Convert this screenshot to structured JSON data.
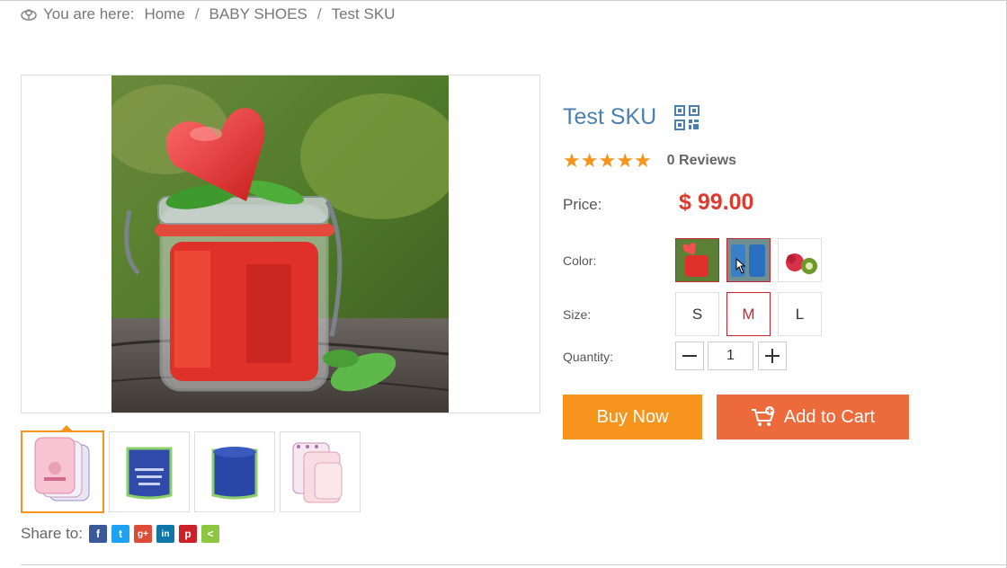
{
  "breadcrumb": {
    "prefix": "You are here:",
    "items": [
      "Home",
      "BABY SHOES",
      "Test SKU"
    ],
    "separator": "/"
  },
  "product": {
    "title": "Test SKU",
    "rating_stars": 5,
    "reviews_label": "0 Reviews",
    "price_label": "Price:",
    "price": "$ 99.00",
    "color_label": "Color:",
    "size_label": "Size:",
    "quantity_label": "Quantity:",
    "sizes": [
      "S",
      "M",
      "L"
    ],
    "selected_size": "M",
    "quantity": "1"
  },
  "actions": {
    "buy_now": "Buy Now",
    "add_to_cart": "Add to Cart"
  },
  "share": {
    "label": "Share to:",
    "networks": [
      {
        "name": "facebook",
        "glyph": "f",
        "color": "#3b5998"
      },
      {
        "name": "twitter",
        "glyph": "t",
        "color": "#1da1f2"
      },
      {
        "name": "google-plus",
        "glyph": "g+",
        "color": "#dd4b39"
      },
      {
        "name": "linkedin",
        "glyph": "in",
        "color": "#0e76a8"
      },
      {
        "name": "pinterest",
        "glyph": "p",
        "color": "#cb2027"
      },
      {
        "name": "sharethis",
        "glyph": "<",
        "color": "#8dc63f"
      }
    ]
  },
  "colors": {
    "accent_orange": "#f7941d",
    "cart_orange": "#ed6a3a",
    "price_red": "#e03a2e",
    "title_blue": "#4a7faf",
    "selected_border": "#c8262c"
  }
}
